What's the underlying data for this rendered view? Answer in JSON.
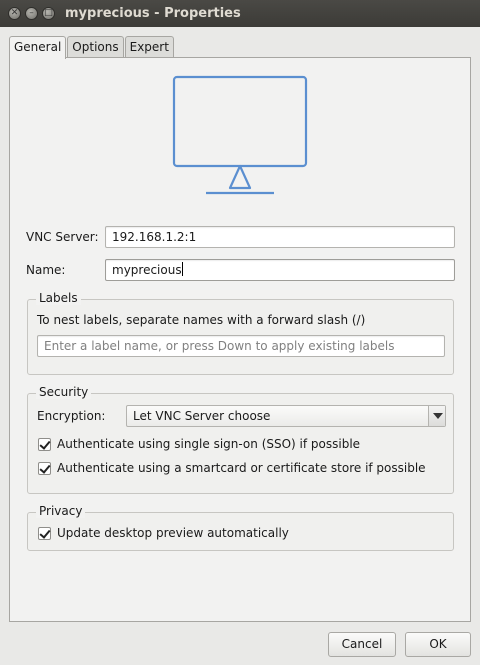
{
  "window": {
    "title": "myprecious - Properties",
    "controls": [
      "close-icon",
      "minimize-icon",
      "maximize-icon"
    ]
  },
  "tabs": [
    {
      "label": "General",
      "active": true
    },
    {
      "label": "Options",
      "active": false
    },
    {
      "label": "Expert",
      "active": false
    }
  ],
  "general": {
    "preview_icon": "monitor-icon",
    "vnc_server_label": "VNC Server:",
    "vnc_server_value": "192.168.1.2:1",
    "name_label": "Name:",
    "name_value": "myprecious",
    "labels_group": {
      "title": "Labels",
      "hint": "To nest labels, separate names with a forward slash (/)",
      "placeholder": "Enter a label name, or press Down to apply existing labels"
    },
    "security_group": {
      "title": "Security",
      "encryption_label": "Encryption:",
      "encryption_value": "Let VNC Server choose",
      "sso_label": "Authenticate using single sign-on (SSO) if possible",
      "sso_checked": true,
      "smartcard_label": "Authenticate using a smartcard or certificate store if possible",
      "smartcard_checked": true
    },
    "privacy_group": {
      "title": "Privacy",
      "preview_label": "Update desktop preview automatically",
      "preview_checked": true
    }
  },
  "footer": {
    "cancel_label": "Cancel",
    "ok_label": "OK"
  },
  "colors": {
    "monitor_stroke": "#5b8fd0",
    "titlebar": "#3c3b37",
    "window_bg": "#e9e9e7"
  }
}
